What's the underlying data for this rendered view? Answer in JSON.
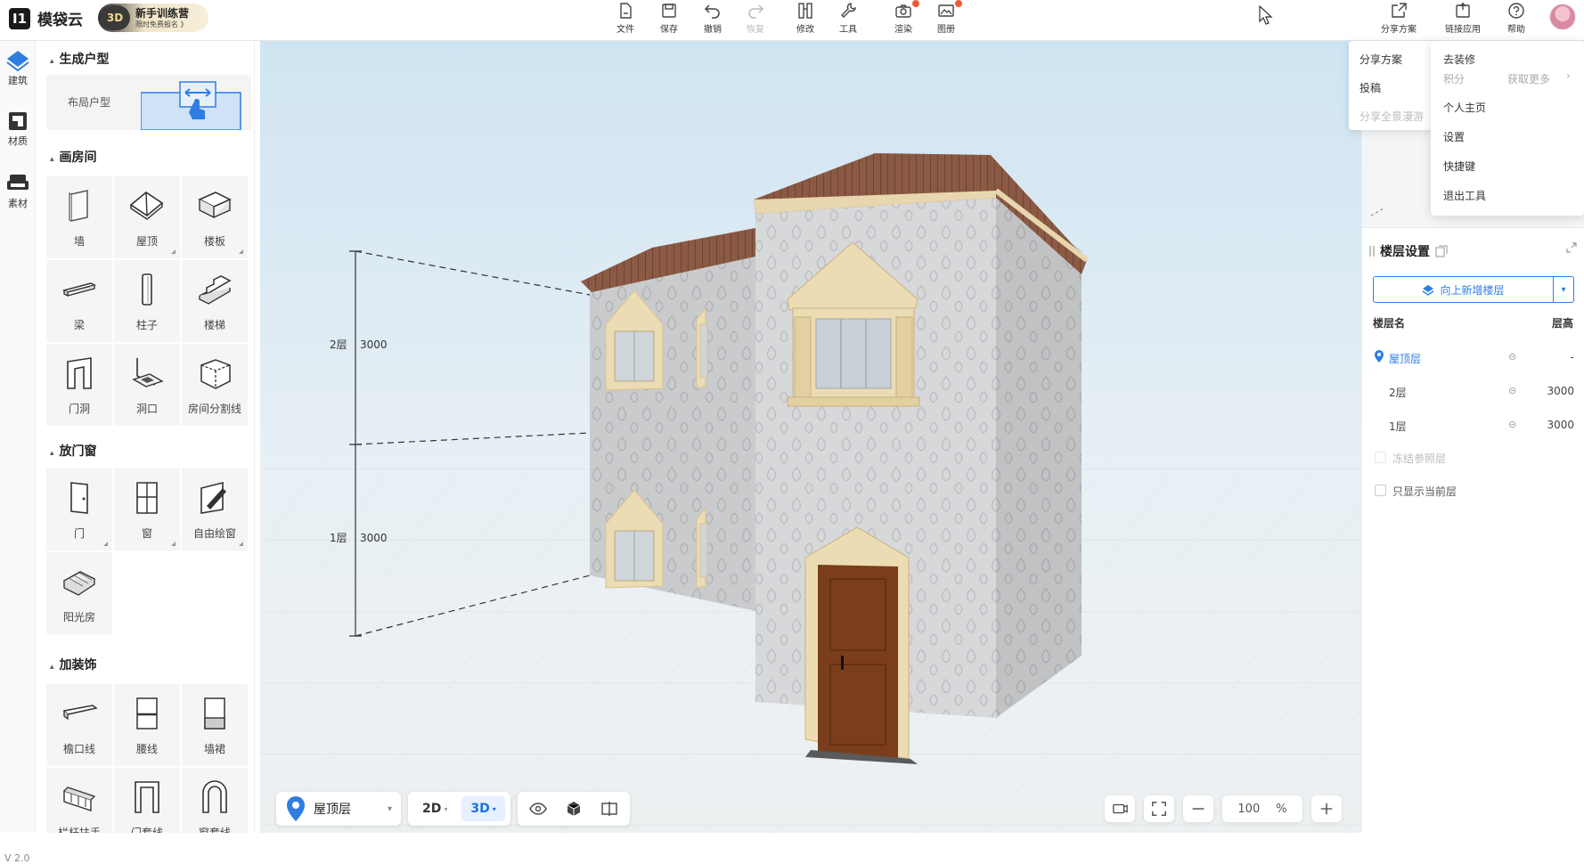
{
  "app": {
    "logo_mark": "I1",
    "name": "模袋云",
    "version": "V 2.0"
  },
  "promo": {
    "badge": "3D",
    "title": "新手训练营",
    "subtitle": "限时免费报名 》"
  },
  "toolbar": [
    {
      "label": "文件",
      "icon": "file-icon"
    },
    {
      "label": "保存",
      "icon": "save-icon"
    },
    {
      "label": "撤销",
      "icon": "undo-icon"
    },
    {
      "label": "恢复",
      "icon": "redo-icon"
    },
    {
      "label": "修改",
      "icon": "edit-icon"
    },
    {
      "label": "工具",
      "icon": "wrench-icon"
    },
    {
      "label": "渲染",
      "icon": "camera-icon"
    },
    {
      "label": "图册",
      "icon": "album-icon"
    }
  ],
  "top_right": {
    "share": "分享方案",
    "link": "链接应用",
    "help": "帮助"
  },
  "rail": [
    {
      "label": "建筑"
    },
    {
      "label": "材质"
    },
    {
      "label": "素材"
    }
  ],
  "panel": {
    "generate": {
      "title": "生成户型",
      "layout_label": "布局户型"
    },
    "rooms": {
      "title": "画房间",
      "items": [
        "墙",
        "屋顶",
        "楼板",
        "梁",
        "柱子",
        "楼梯",
        "门洞",
        "洞口",
        "房间分割线"
      ]
    },
    "doors": {
      "title": "放门窗",
      "items": [
        "门",
        "窗",
        "自由绘窗",
        "阳光房"
      ]
    },
    "decor": {
      "title": "加装饰",
      "items": [
        "檐口线",
        "腰线",
        "墙裙",
        "栏杆扶手",
        "门套线",
        "窗套线"
      ]
    }
  },
  "viewport": {
    "dims": [
      {
        "label": "2层",
        "value": "3000"
      },
      {
        "label": "1层",
        "value": "3000"
      }
    ]
  },
  "bottom": {
    "floor": "屋顶层",
    "mode_2d": "2D",
    "mode_3d": "3D",
    "zoom": "100",
    "zoom_unit": "%"
  },
  "menu_share": {
    "items": [
      "分享方案",
      "投稿",
      "分享全景漫游"
    ]
  },
  "menu_user": {
    "items": [
      "去装修",
      "积分",
      "个人主页",
      "设置",
      "快捷键",
      "退出工具"
    ],
    "more": "获取更多"
  },
  "floor_settings": {
    "title": "楼层设置",
    "add_button": "向上新增楼层",
    "col_name": "楼层名",
    "col_height": "层高",
    "rows": [
      {
        "name": "屋顶层",
        "height": "-"
      },
      {
        "name": "2层",
        "height": "3000"
      },
      {
        "name": "1层",
        "height": "3000"
      }
    ],
    "option_ref": "冻结参照层",
    "option_current": "只显示当前层"
  },
  "colors": {
    "accent": "#2f7de1",
    "wall": "#d9d9d9",
    "roof": "#8a5a45",
    "trim": "#ead8b3",
    "door": "#7a3e1c"
  }
}
